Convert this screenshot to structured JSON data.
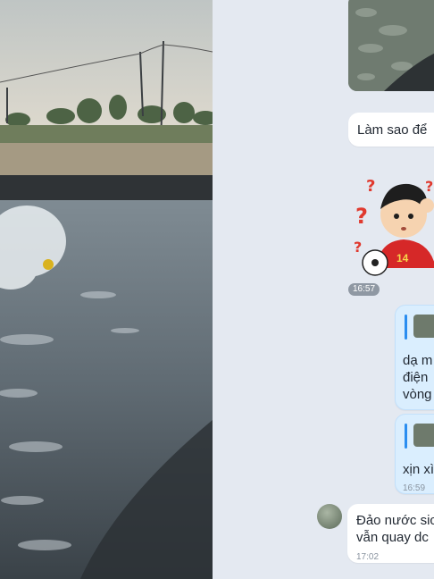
{
  "left_photo": {
    "description_icon": "pond-aerator-photo"
  },
  "chat": {
    "messages": [
      {
        "id": "m1",
        "text": "Làm sao để"
      },
      {
        "id": "m2",
        "sticker_number": "14",
        "time": "16:57"
      },
      {
        "id": "m3",
        "line1": "dạ m",
        "line2": "điện",
        "line3": "vòng"
      },
      {
        "id": "m4",
        "text": "xịn xì",
        "time": "16:59"
      },
      {
        "id": "m5",
        "line1": "Đảo nước sic",
        "line2": "vẫn quay dc",
        "time": "17:02"
      }
    ]
  },
  "colors": {
    "chat_bg": "#e4e9f1",
    "own_bubble": "#daeefe",
    "quote_accent": "#2a8df0"
  }
}
